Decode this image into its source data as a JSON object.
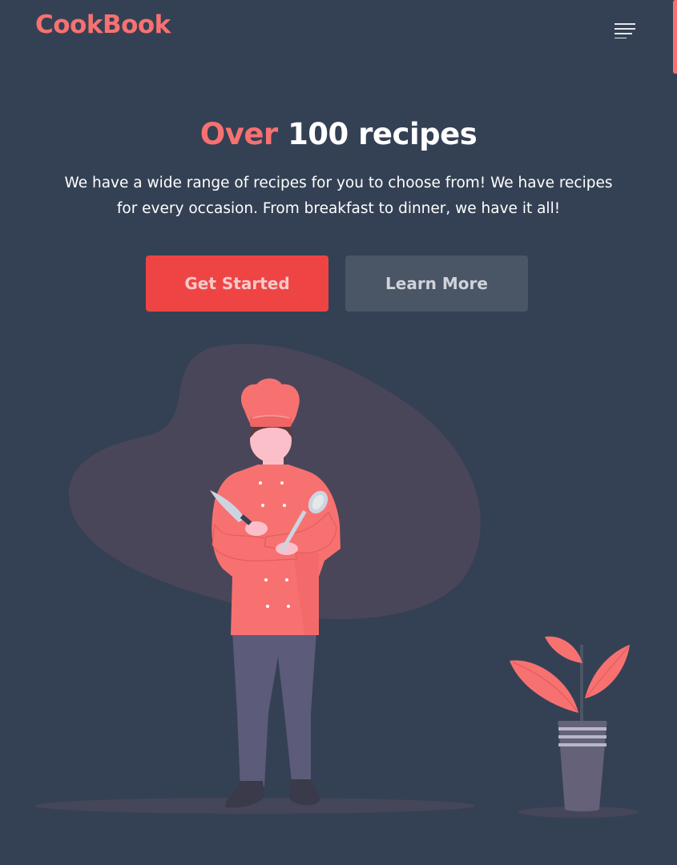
{
  "header": {
    "logo": "CookBook",
    "menu_icon": "hamburger-menu-icon"
  },
  "hero": {
    "title_accent": "Over",
    "title_rest": "100 recipes",
    "description": "We have a wide range of recipes for you to choose from! We have recipes for every occasion. From breakfast to dinner, we have it all!"
  },
  "buttons": {
    "primary_label": "Get Started",
    "secondary_label": "Learn More"
  },
  "illustration": {
    "subject": "chef-illustration",
    "decor": "potted-plant-illustration"
  },
  "colors": {
    "background": "#344154",
    "accent": "#f87171",
    "primary_button": "#ef4444",
    "secondary_button": "#4a5565",
    "blob": "#4a4659"
  }
}
